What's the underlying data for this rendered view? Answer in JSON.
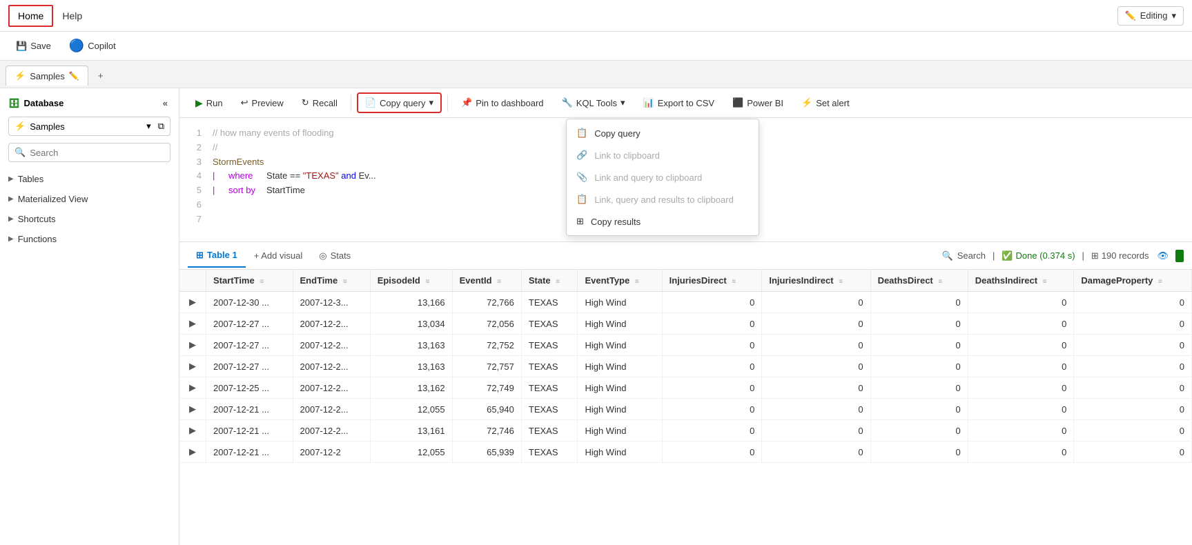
{
  "topbar": {
    "nav_items": [
      {
        "label": "Home",
        "active": true
      },
      {
        "label": "Help",
        "active": false
      }
    ],
    "editing_label": "Editing",
    "editing_icon": "✏️"
  },
  "toolbar": {
    "save_label": "Save",
    "copilot_label": "Copilot"
  },
  "tabs": {
    "items": [
      {
        "label": "Samples",
        "active": true
      }
    ],
    "add_label": "+"
  },
  "sidebar": {
    "title": "Database",
    "database_name": "Samples",
    "search_placeholder": "Search",
    "sections": [
      {
        "label": "Tables"
      },
      {
        "label": "Materialized View"
      },
      {
        "label": "Shortcuts"
      },
      {
        "label": "Functions"
      }
    ]
  },
  "query_toolbar": {
    "run_label": "Run",
    "preview_label": "Preview",
    "recall_label": "Recall",
    "copy_query_label": "Copy query",
    "pin_dashboard_label": "Pin to dashboard",
    "kql_tools_label": "KQL Tools",
    "export_csv_label": "Export to CSV",
    "power_bi_label": "Power BI",
    "set_alert_label": "Set alert"
  },
  "copy_dropdown": {
    "items": [
      {
        "label": "Copy query",
        "icon": "📋",
        "disabled": false
      },
      {
        "label": "Link to clipboard",
        "icon": "🔗",
        "disabled": true
      },
      {
        "label": "Link and query to clipboard",
        "icon": "📎",
        "disabled": true
      },
      {
        "label": "Link, query and results to clipboard",
        "icon": "📋",
        "disabled": true
      },
      {
        "label": "Copy results",
        "icon": "⊞",
        "disabled": false
      }
    ]
  },
  "code": {
    "lines": [
      {
        "num": 1,
        "content": "// how many events of flooding",
        "type": "comment"
      },
      {
        "num": 2,
        "content": "//",
        "type": "comment"
      },
      {
        "num": 3,
        "content": "StormEvents",
        "type": "table"
      },
      {
        "num": 4,
        "content": "| where State == \"TEXAS\" and Ev...",
        "type": "filter"
      },
      {
        "num": 5,
        "content": "| sort by StartTime",
        "type": "filter"
      },
      {
        "num": 6,
        "content": "",
        "type": "empty"
      },
      {
        "num": 7,
        "content": "",
        "type": "empty"
      }
    ]
  },
  "results": {
    "table_tab_label": "Table 1",
    "add_visual_label": "+ Add visual",
    "stats_label": "Stats",
    "search_label": "Search",
    "done_label": "Done (0.374 s)",
    "records_label": "190 records",
    "columns": [
      {
        "label": "StartTime"
      },
      {
        "label": "EndTime"
      },
      {
        "label": "EpisodeId"
      },
      {
        "label": "EventId"
      },
      {
        "label": "State"
      },
      {
        "label": "EventType"
      },
      {
        "label": "InjuriesDirect"
      },
      {
        "label": "InjuriesIndirect"
      },
      {
        "label": "DeathsDirect"
      },
      {
        "label": "DeathsIndirect"
      },
      {
        "label": "DamageProperty"
      }
    ],
    "rows": [
      {
        "start": "2007-12-30 ...",
        "end": "2007-12-3...",
        "episode": "13,166",
        "event": "72,766",
        "state": "TEXAS",
        "type": "High Wind",
        "inj_d": "0",
        "inj_i": "0",
        "dth_d": "0",
        "dth_i": "0",
        "damage": "0"
      },
      {
        "start": "2007-12-27 ...",
        "end": "2007-12-2...",
        "episode": "13,034",
        "event": "72,056",
        "state": "TEXAS",
        "type": "High Wind",
        "inj_d": "0",
        "inj_i": "0",
        "dth_d": "0",
        "dth_i": "0",
        "damage": "0"
      },
      {
        "start": "2007-12-27 ...",
        "end": "2007-12-2...",
        "episode": "13,163",
        "event": "72,752",
        "state": "TEXAS",
        "type": "High Wind",
        "inj_d": "0",
        "inj_i": "0",
        "dth_d": "0",
        "dth_i": "0",
        "damage": "0"
      },
      {
        "start": "2007-12-27 ...",
        "end": "2007-12-2...",
        "episode": "13,163",
        "event": "72,757",
        "state": "TEXAS",
        "type": "High Wind",
        "inj_d": "0",
        "inj_i": "0",
        "dth_d": "0",
        "dth_i": "0",
        "damage": "0"
      },
      {
        "start": "2007-12-25 ...",
        "end": "2007-12-2...",
        "episode": "13,162",
        "event": "72,749",
        "state": "TEXAS",
        "type": "High Wind",
        "inj_d": "0",
        "inj_i": "0",
        "dth_d": "0",
        "dth_i": "0",
        "damage": "0"
      },
      {
        "start": "2007-12-21 ...",
        "end": "2007-12-2...",
        "episode": "12,055",
        "event": "65,940",
        "state": "TEXAS",
        "type": "High Wind",
        "inj_d": "0",
        "inj_i": "0",
        "dth_d": "0",
        "dth_i": "0",
        "damage": "0"
      },
      {
        "start": "2007-12-21 ...",
        "end": "2007-12-2...",
        "episode": "13,161",
        "event": "72,746",
        "state": "TEXAS",
        "type": "High Wind",
        "inj_d": "0",
        "inj_i": "0",
        "dth_d": "0",
        "dth_i": "0",
        "damage": "0"
      },
      {
        "start": "2007-12-21 ...",
        "end": "2007-12-2",
        "episode": "12,055",
        "event": "65,939",
        "state": "TEXAS",
        "type": "High Wind",
        "inj_d": "0",
        "inj_i": "0",
        "dth_d": "0",
        "dth_i": "0",
        "damage": "0"
      }
    ]
  }
}
